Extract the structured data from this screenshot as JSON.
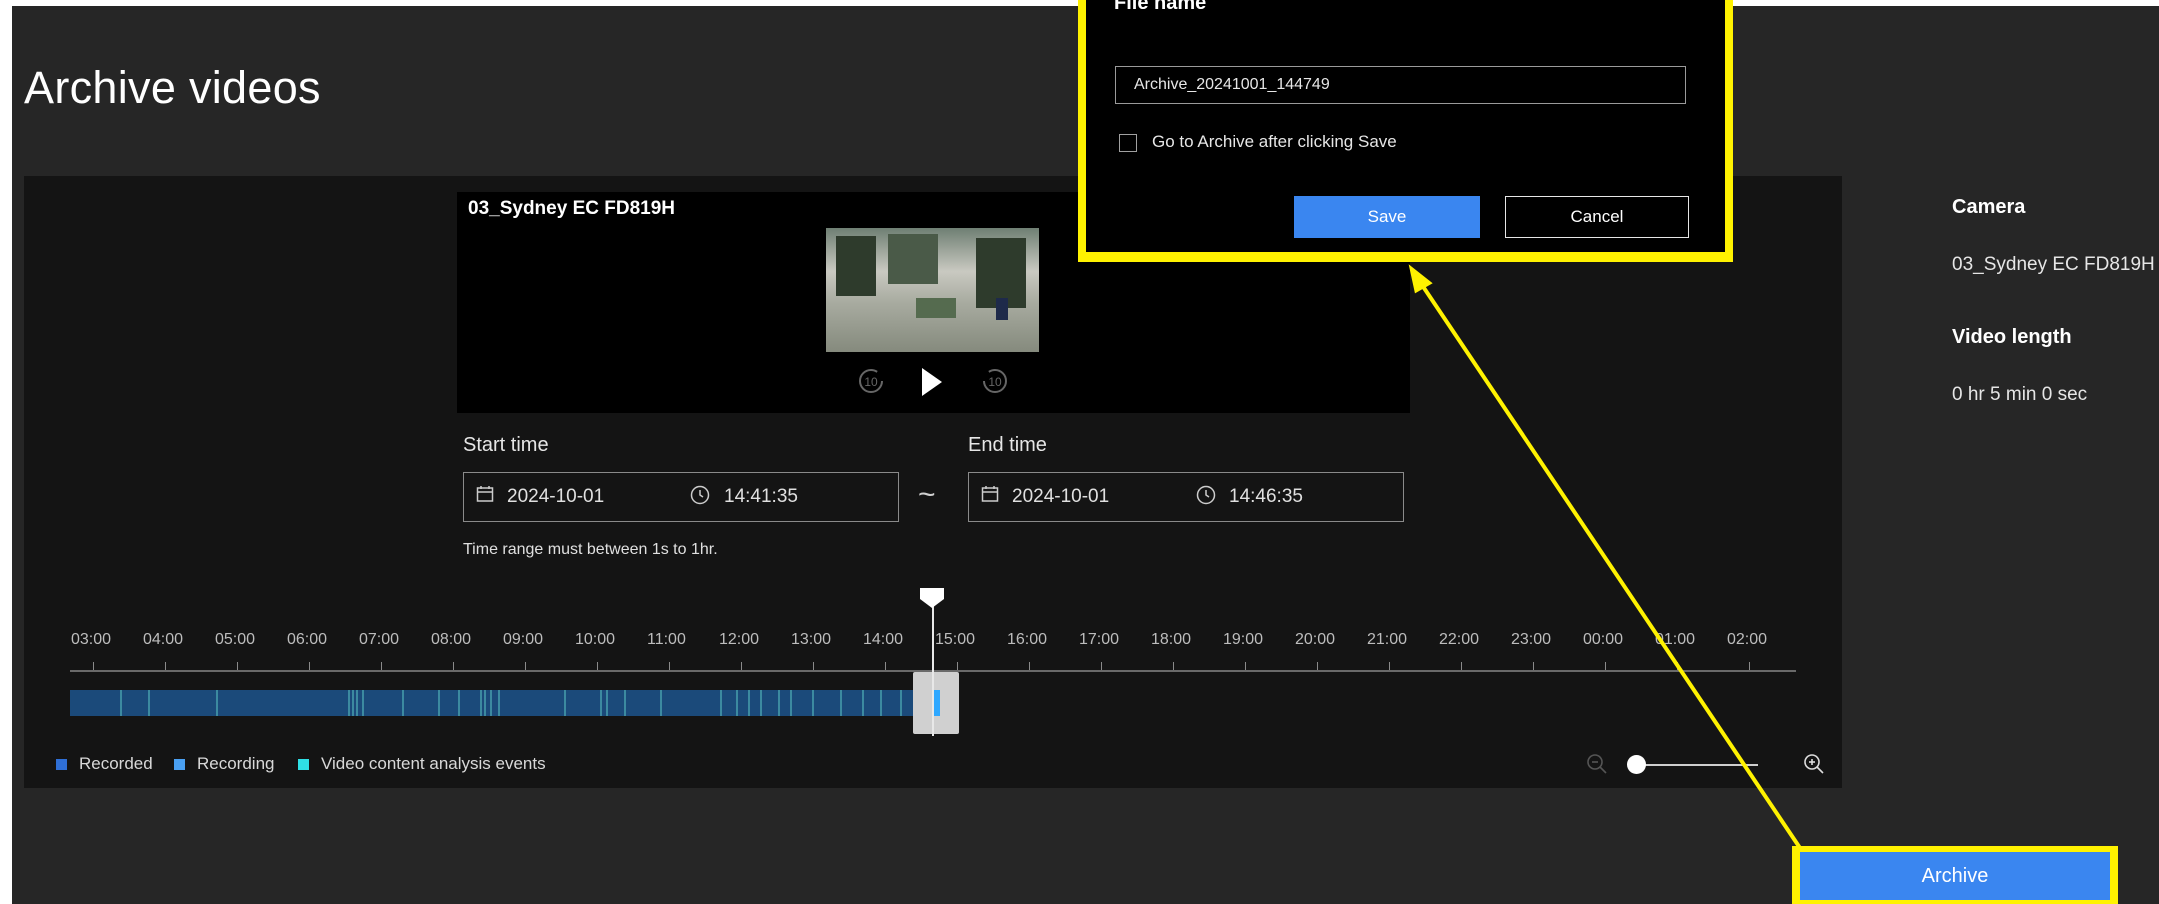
{
  "page": {
    "title": "Archive videos"
  },
  "player": {
    "camera_name": "03_Sydney EC FD819H",
    "rewind_label": "10",
    "forward_label": "10"
  },
  "range": {
    "start_label": "Start time",
    "start_date": "2024-10-01",
    "start_time": "14:41:35",
    "separator": "~",
    "end_label": "End time",
    "end_date": "2024-10-01",
    "end_time": "14:46:35",
    "hint": "Time range must between 1s to 1hr."
  },
  "timeline": {
    "ticks": [
      "03:00",
      "04:00",
      "05:00",
      "06:00",
      "07:00",
      "08:00",
      "09:00",
      "10:00",
      "11:00",
      "12:00",
      "13:00",
      "14:00",
      "15:00",
      "16:00",
      "17:00",
      "18:00",
      "19:00",
      "20:00",
      "21:00",
      "22:00",
      "23:00",
      "00:00",
      "01:00",
      "02:00"
    ]
  },
  "legend": [
    {
      "label": "Recorded",
      "color": "#2f6fd6"
    },
    {
      "label": "Recording",
      "color": "#4aa0f2"
    },
    {
      "label": "Video content analysis events",
      "color": "#2fe0e6"
    }
  ],
  "zoom": {
    "level": 0.0
  },
  "sidebar": {
    "camera_heading": "Camera",
    "camera_value": "03_Sydney EC FD819H",
    "length_heading": "Video length",
    "length_value": "0 hr 5 min 0 sec"
  },
  "archive_button": "Archive",
  "dialog": {
    "title": "File name",
    "filename": "Archive_20241001_144749",
    "checkbox_label": "Go to Archive after clicking Save",
    "checkbox_checked": false,
    "save_label": "Save",
    "cancel_label": "Cancel"
  },
  "colors": {
    "accent": "#3a86f0",
    "highlight": "#fff200"
  }
}
